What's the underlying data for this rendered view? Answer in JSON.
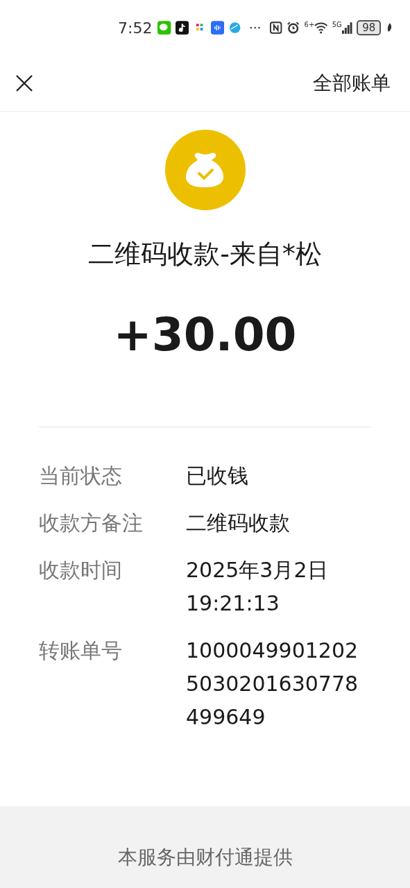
{
  "status_bar": {
    "time": "7:52",
    "wifi_tag": "6+",
    "network": "5G",
    "battery": "98"
  },
  "nav": {
    "action": "全部账单"
  },
  "title": "二维码收款-来自*松",
  "amount": "+30.00",
  "details": [
    {
      "label": "当前状态",
      "value": "已收钱"
    },
    {
      "label": "收款方备注",
      "value": "二维码收款"
    },
    {
      "label": "收款时间",
      "value": "2025年3月2日 19:21:13"
    },
    {
      "label": "转账单号",
      "value": "10000499012025030201630778499649"
    }
  ],
  "footer": "本服务由财付通提供"
}
